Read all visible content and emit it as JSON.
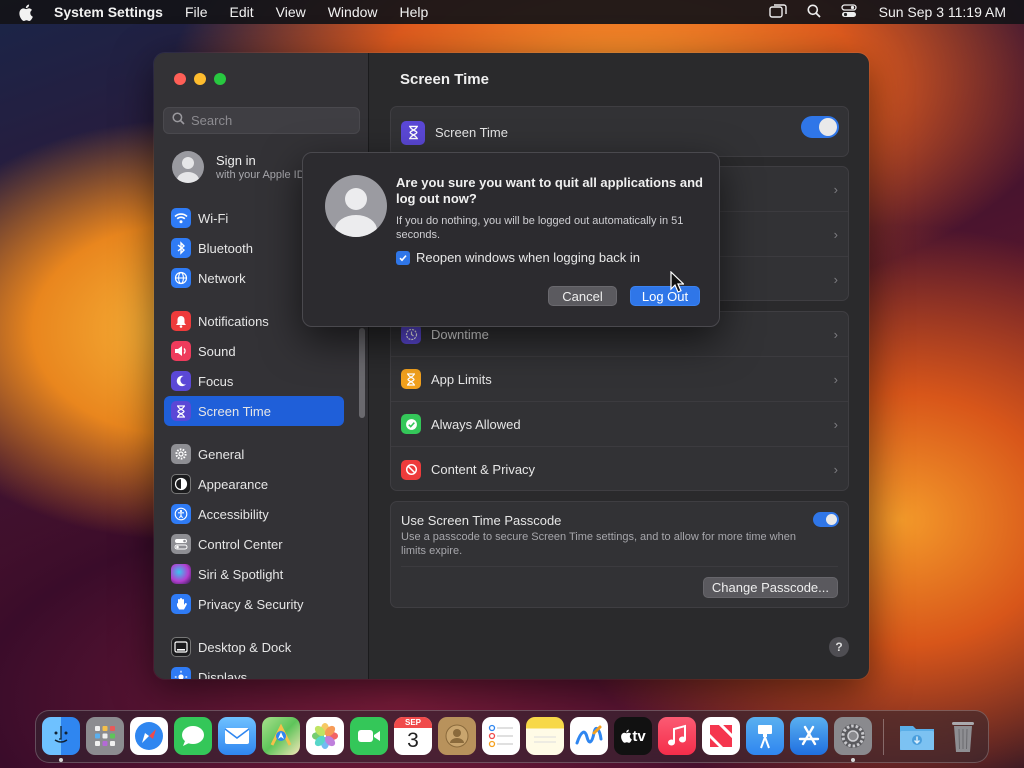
{
  "menubar": {
    "app_name": "System Settings",
    "menus": [
      "File",
      "Edit",
      "View",
      "Window",
      "Help"
    ],
    "clock": "Sun Sep 3  11:19 AM"
  },
  "sidebar": {
    "search_placeholder": "Search",
    "signin_title": "Sign in",
    "signin_subtitle": "with your Apple ID",
    "groups": [
      [
        {
          "label": "Wi-Fi",
          "icon": "wifi-icon",
          "color": "#2f7bf5"
        },
        {
          "label": "Bluetooth",
          "icon": "bluetooth-icon",
          "color": "#2f7bf5"
        },
        {
          "label": "Network",
          "icon": "globe-icon",
          "color": "#2f7bf5"
        }
      ],
      [
        {
          "label": "Notifications",
          "icon": "bell-icon",
          "color": "#ee3b3b"
        },
        {
          "label": "Sound",
          "icon": "speaker-icon",
          "color": "#ee3b5c"
        },
        {
          "label": "Focus",
          "icon": "moon-icon",
          "color": "#5b48d6"
        },
        {
          "label": "Screen Time",
          "icon": "hourglass-icon",
          "color": "#5b48d6",
          "active": true
        }
      ],
      [
        {
          "label": "General",
          "icon": "gear-icon",
          "color": "#8e8e93"
        },
        {
          "label": "Appearance",
          "icon": "appearance-icon",
          "color": "#1c1c1e"
        },
        {
          "label": "Accessibility",
          "icon": "accessibility-icon",
          "color": "#2f7bf5"
        },
        {
          "label": "Control Center",
          "icon": "switches-icon",
          "color": "#8e8e93"
        },
        {
          "label": "Siri & Spotlight",
          "icon": "siri-icon",
          "color": "#b43ed0"
        },
        {
          "label": "Privacy & Security",
          "icon": "hand-icon",
          "color": "#2f7bf5"
        }
      ],
      [
        {
          "label": "Desktop & Dock",
          "icon": "dock-icon",
          "color": "#1c1c1e"
        },
        {
          "label": "Displays",
          "icon": "sun-icon",
          "color": "#2f7bf5"
        }
      ]
    ]
  },
  "content": {
    "title": "Screen Time",
    "toggle_row_label": "Screen Time",
    "list_rows": [
      {
        "label": "Downtime",
        "icon": "downtime-icon",
        "color": "#5b48d6"
      },
      {
        "label": "App Limits",
        "icon": "hourglass-icon",
        "color": "#f2a11e"
      },
      {
        "label": "Always Allowed",
        "icon": "checkmark-icon",
        "color": "#34c759"
      },
      {
        "label": "Content & Privacy",
        "icon": "restricted-icon",
        "color": "#ee3b3b"
      }
    ],
    "passcode": {
      "title": "Use Screen Time Passcode",
      "description": "Use a passcode to secure Screen Time settings, and to allow for more time when limits expire.",
      "button": "Change Passcode..."
    },
    "help": "?"
  },
  "dialog": {
    "title": "Are you sure you want to quit all applications and log out now?",
    "message": "If you do nothing, you will be logged out automatically in 51 seconds.",
    "checkbox_label": "Reopen windows when logging back in",
    "cancel": "Cancel",
    "confirm": "Log Out"
  },
  "dock": {
    "apps": [
      {
        "name": "finder",
        "color": "#3a8ef0"
      },
      {
        "name": "launchpad",
        "color": "#8c8c90"
      },
      {
        "name": "safari",
        "color": "#2f86f0"
      },
      {
        "name": "messages",
        "color": "#34c759"
      },
      {
        "name": "mail",
        "color": "#2f86f0"
      },
      {
        "name": "maps",
        "color": "#5ec45a"
      },
      {
        "name": "photos",
        "color": "#f2f2f2"
      },
      {
        "name": "facetime",
        "color": "#34c759"
      },
      {
        "name": "calendar",
        "color": "#f7f7f7"
      },
      {
        "name": "contacts",
        "color": "#b8925c"
      },
      {
        "name": "reminders",
        "color": "#f7f7f7"
      },
      {
        "name": "notes",
        "color": "#f7d848"
      },
      {
        "name": "freeform",
        "color": "#f7f7f7"
      },
      {
        "name": "tv",
        "color": "#111111"
      },
      {
        "name": "music",
        "color": "#fa3d56"
      },
      {
        "name": "news",
        "color": "#f7f7f7"
      },
      {
        "name": "keynote",
        "color": "#2f86f0"
      },
      {
        "name": "app-store",
        "color": "#2f86f0"
      },
      {
        "name": "system-settings",
        "color": "#8a8a8e"
      }
    ],
    "extras": [
      {
        "name": "downloads",
        "color": "#5aaee8"
      },
      {
        "name": "trash",
        "color": "#7a7a7e"
      }
    ],
    "calendar_month": "SEP",
    "calendar_day": "3",
    "tv_label": "tv"
  }
}
